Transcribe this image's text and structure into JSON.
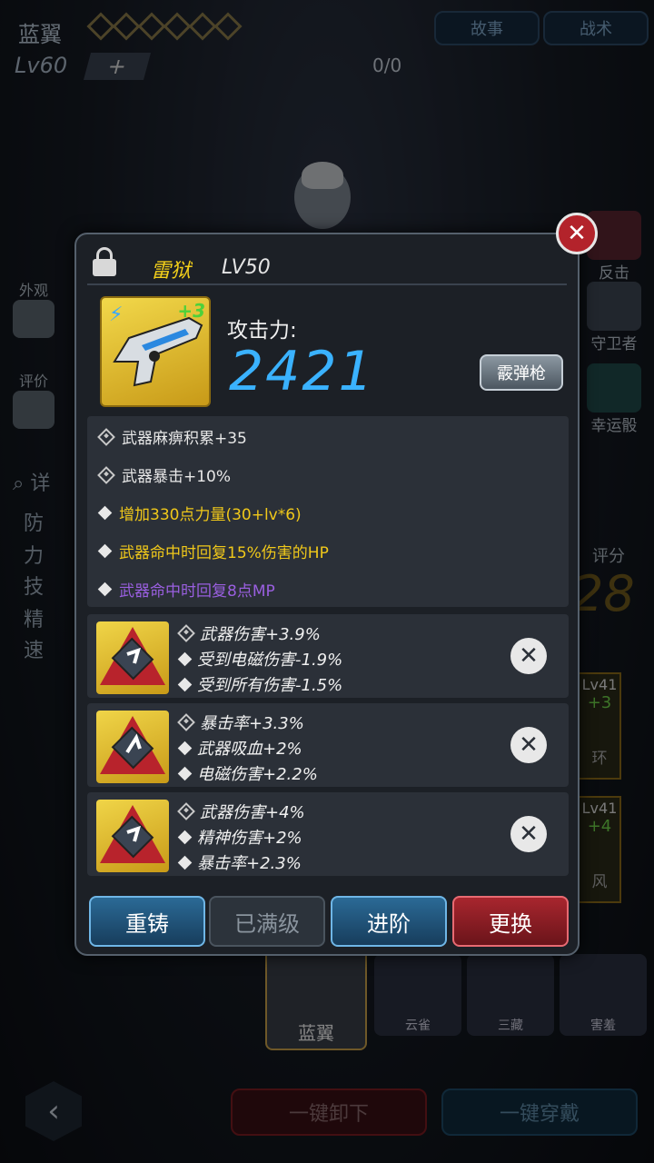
{
  "hero": {
    "name": "蓝翼",
    "level": "Lv60",
    "add": "+",
    "exp": "0/0"
  },
  "top_buttons": {
    "story": "故事",
    "tactics": "战术"
  },
  "left_side": {
    "appearance": "外观",
    "rating": "评价",
    "detail": "详"
  },
  "stats_partial": [
    "防",
    "力",
    "技",
    "精",
    "速"
  ],
  "right_side": {
    "counter": "反击",
    "guardian": "守卫者",
    "lucky": "幸运骰"
  },
  "score": {
    "label": "评分",
    "value": "28"
  },
  "right_cards": [
    {
      "level": "Lv41",
      "plus": "+3",
      "name": "环"
    },
    {
      "level": "Lv41",
      "plus": "+4",
      "name": "风"
    }
  ],
  "hero_tabs": {
    "selected": "蓝翼",
    "others": [
      "云雀",
      "三藏",
      "害羞"
    ]
  },
  "bottom": {
    "unequip_all": "一键卸下",
    "equip_all": "一键穿戴",
    "back": "‹"
  },
  "popup": {
    "close": "✕",
    "weapon_name": "雷狱",
    "weapon_level": "LV50",
    "plus": "+3",
    "attack_label": "攻击力:",
    "attack_value": "2421",
    "weapon_type": "霰弹枪",
    "attributes": [
      {
        "text": "武器麻痹积累+35",
        "color": "#e8e8e8",
        "icon": "gem-socket-icon"
      },
      {
        "text": "武器暴击+10%",
        "color": "#e8e8e8",
        "icon": "gem-socket-icon"
      },
      {
        "text": "增加330点力量(30+lv*6)",
        "color": "#f0c81a",
        "icon": "diamond-bullet-icon"
      },
      {
        "text": "武器命中时回复15%伤害的HP",
        "color": "#f0c81a",
        "icon": "diamond-bullet-icon"
      },
      {
        "text": "武器命中时回复8点MP",
        "color": "#9a5fe0",
        "icon": "diamond-bullet-icon"
      }
    ],
    "mods": [
      {
        "lines": [
          "武器伤害+3.9%",
          "受到电磁伤害-1.9%",
          "受到所有伤害-1.5%"
        ]
      },
      {
        "lines": [
          "暴击率+3.3%",
          "武器吸血+2%",
          "电磁伤害+2.2%"
        ]
      },
      {
        "lines": [
          "武器伤害+4%",
          "精神伤害+2%",
          "暴击率+2.3%"
        ]
      }
    ],
    "actions": {
      "reforge": "重铸",
      "maxed": "已满级",
      "advance": "进阶",
      "replace": "更换"
    }
  }
}
